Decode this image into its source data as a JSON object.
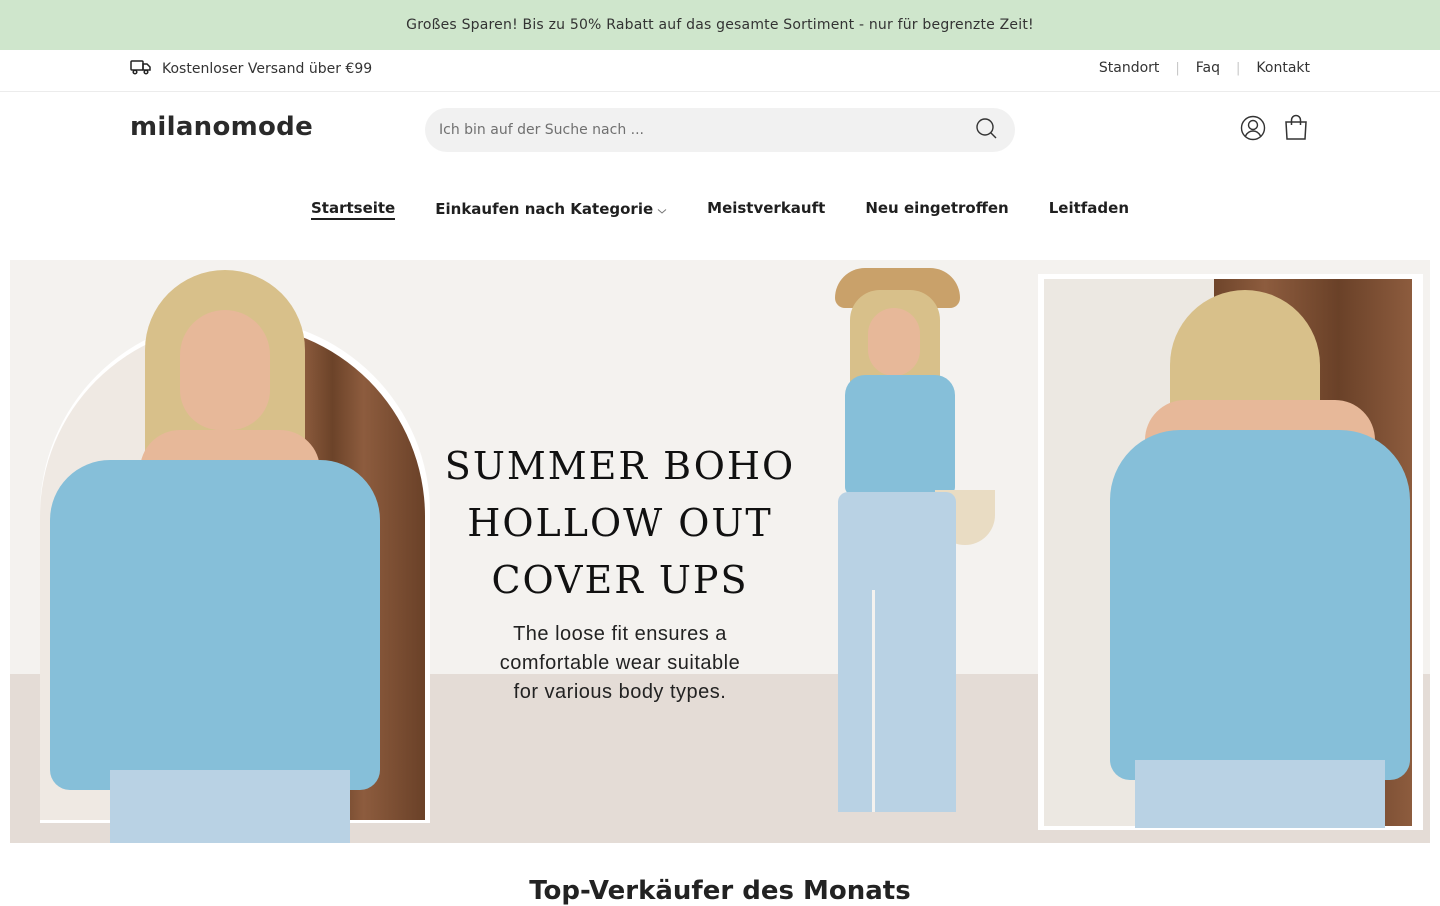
{
  "announcement": "Großes Sparen! Bis zu 50% Rabatt auf das gesamte Sortiment - nur für begrenzte Zeit!",
  "utility": {
    "shipping": "Kostenloser Versand über €99",
    "links": [
      "Standort",
      "Faq",
      "Kontakt"
    ]
  },
  "header": {
    "logo": "milanomode",
    "search_placeholder": "Ich bin auf der Suche nach ..."
  },
  "nav": {
    "items": [
      "Startseite",
      "Einkaufen nach Kategorie",
      "Meistverkauft",
      "Neu eingetroffen",
      "Leitfaden"
    ],
    "active": "Startseite"
  },
  "hero": {
    "headline_lines": [
      "SUMMER BOHO",
      "HOLLOW OUT",
      "COVER UPS"
    ],
    "sub_lines": [
      "The loose fit ensures a",
      "comfortable wear suitable",
      "for various body types."
    ]
  },
  "section_title": "Top-Verkäufer des Monats",
  "colors": {
    "announcement_bg": "#cfe6cc",
    "search_bg": "#f1f1f1",
    "text": "#222222",
    "top_blue": "#86bfd9"
  },
  "icons": [
    "truck-icon",
    "search-icon",
    "account-icon",
    "bag-icon",
    "chevron-down-icon"
  ]
}
